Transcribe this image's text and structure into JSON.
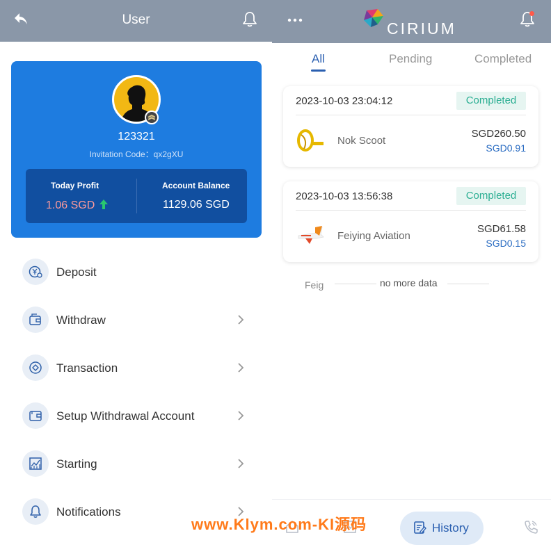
{
  "left": {
    "header": {
      "title": "User"
    },
    "profile": {
      "username": "123321",
      "invitation": "Invitation Code：qx2gXU",
      "today_profit_label": "Today Profit",
      "today_profit_value": "1.06 SGD",
      "account_balance_label": "Account Balance",
      "account_balance_value": "1129.06 SGD"
    },
    "menu": [
      {
        "label": "Deposit",
        "icon": "deposit-icon"
      },
      {
        "label": "Withdraw",
        "icon": "wallet-icon"
      },
      {
        "label": "Transaction",
        "icon": "transaction-icon"
      },
      {
        "label": "Setup Withdrawal Account",
        "icon": "card-icon"
      },
      {
        "label": "Starting",
        "icon": "chart-icon"
      },
      {
        "label": "Notifications",
        "icon": "bell-icon"
      }
    ]
  },
  "right": {
    "header": {
      "brand": "CIRIUM"
    },
    "tabs": [
      "All",
      "Pending",
      "Completed"
    ],
    "orders": [
      {
        "time": "2023-10-03 23:04:12",
        "status": "Completed",
        "name": "Nok Scoot",
        "amount": "SGD260.50",
        "fee": "SGD0.91"
      },
      {
        "time": "2023-10-03 13:56:38",
        "status": "Completed",
        "name": "Feiying Aviation",
        "amount": "SGD61.58",
        "fee": "SGD0.15"
      }
    ],
    "no_more": "no more data",
    "ghost_text": "Feig",
    "nav": {
      "history_label": "History"
    }
  },
  "watermark": "www.Klym.com-KI源码",
  "colors": {
    "header_bg": "#8a97a8",
    "card_blue": "#1e7ce0",
    "stats_navy": "#114fa0",
    "profit_red": "#ff9b9b",
    "status_green": "#2aae92",
    "accent_blue": "#2a5fb0",
    "watermark_orange": "#ff7a1a"
  }
}
